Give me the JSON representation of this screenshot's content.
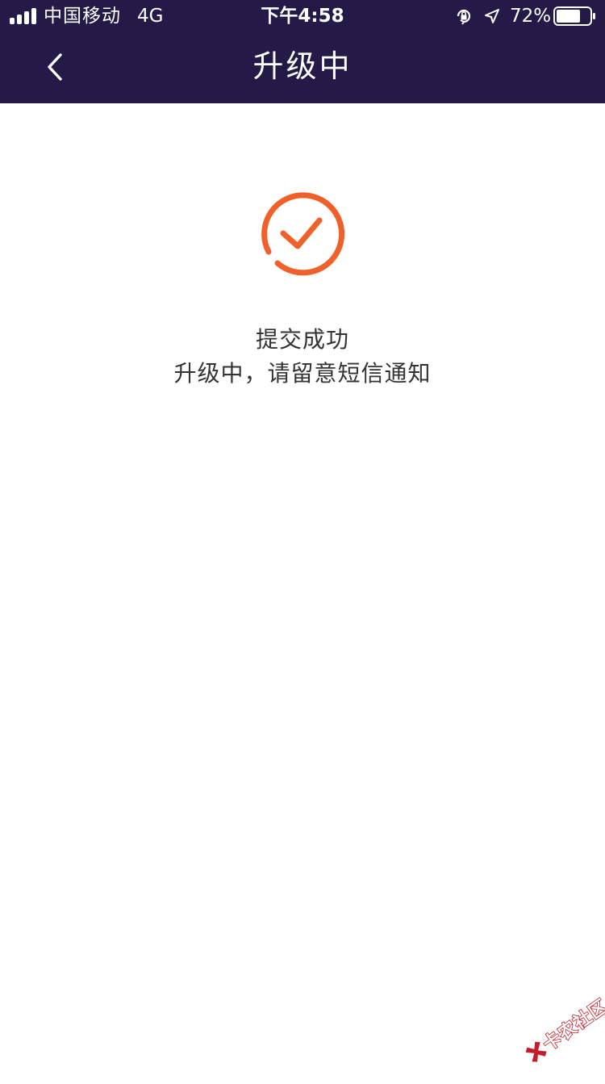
{
  "status_bar": {
    "carrier": "中国移动",
    "network": "4G",
    "time": "下午4:58",
    "battery_percent": "72%",
    "battery_level": 0.72,
    "icons": [
      "signal-icon",
      "orientation-lock-icon",
      "location-icon",
      "battery-icon"
    ]
  },
  "nav": {
    "title": "升级中",
    "back_icon": "chevron-left-icon"
  },
  "result": {
    "icon": "check-circle-icon",
    "title": "提交成功",
    "subtitle": "升级中，请留意短信通知"
  },
  "watermark": {
    "text": "卡农社区"
  },
  "colors": {
    "header_bg": "#231a47",
    "accent": "#f0602a",
    "text": "#333333",
    "background": "#ffffff",
    "watermark": "#c21f2a"
  }
}
